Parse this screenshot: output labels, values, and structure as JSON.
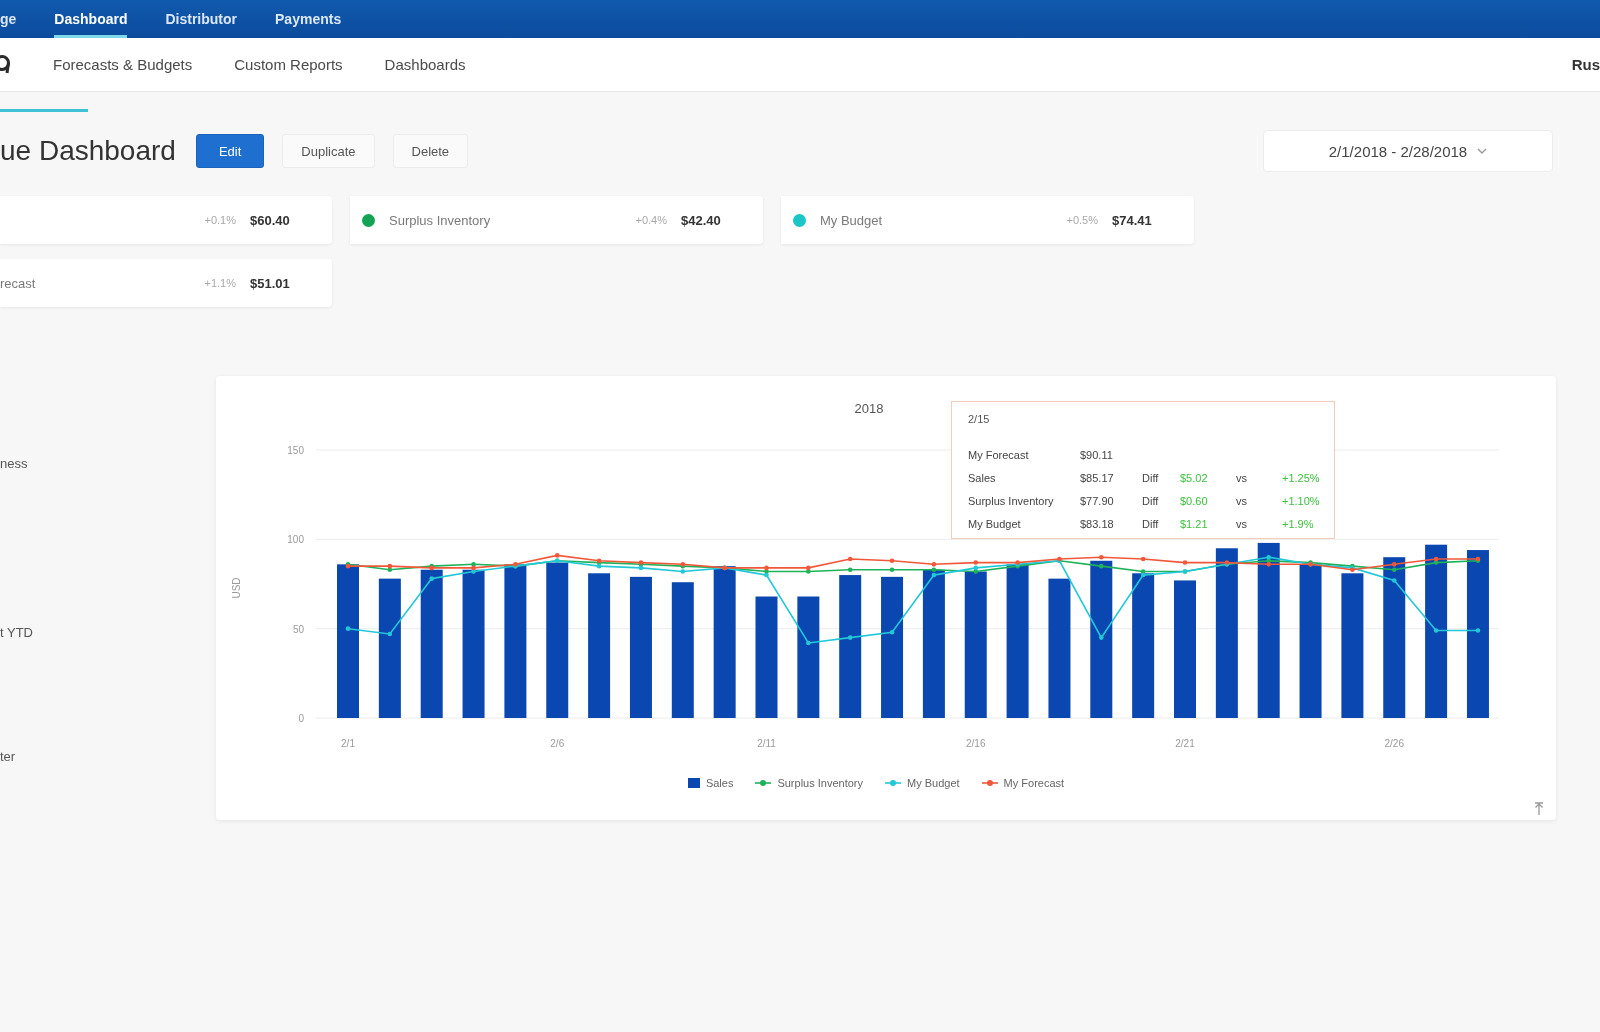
{
  "top_nav": {
    "items": [
      {
        "label": "ge",
        "selected": false
      },
      {
        "label": "Dashboard",
        "selected": true
      },
      {
        "label": "Distributor",
        "selected": false
      },
      {
        "label": "Payments",
        "selected": false
      }
    ]
  },
  "sub_nav": {
    "items": [
      "Forecasts & Budgets",
      "Custom Reports",
      "Dashboards"
    ],
    "user": "Rus"
  },
  "title": "ue Dashboard",
  "actions": [
    {
      "label": "Edit",
      "kind": "primary"
    },
    {
      "label": "Duplicate",
      "kind": "default"
    },
    {
      "label": "Delete",
      "kind": "default"
    }
  ],
  "date_range": {
    "value": "2/1/2018 - 2/28/2018"
  },
  "metric_cards": [
    {
      "change": "+0.1%",
      "value": "$60.40"
    },
    {
      "label": "Surplus Inventory",
      "color": "#12a454",
      "change": "+0.4%",
      "value": "$42.40"
    },
    {
      "label": "My Budget",
      "color": "#1cc6c6",
      "change": "+0.5%",
      "value": "$74.41"
    },
    {
      "label": "recast",
      "change": "+1.1%",
      "value": "$51.01"
    }
  ],
  "sidebar": {
    "items": [
      "ness",
      "t YTD",
      "ter"
    ]
  },
  "chart": {
    "chart_data": [
      {
        "type": "bar",
        "title": "2018",
        "ylabel": "USD",
        "categories": [
          "2/1",
          null,
          null,
          null,
          null,
          "2/6",
          null,
          null,
          null,
          null,
          "2/11",
          null,
          null,
          null,
          null,
          "2/16",
          null,
          null,
          null,
          null,
          "2/21",
          null,
          null,
          null,
          null,
          "2/26",
          null,
          null
        ],
        "ylim": [
          0,
          150
        ],
        "yticks": [
          0,
          50,
          100,
          150
        ],
        "grid": true,
        "legend": "bottom",
        "series": [
          {
            "name": "Sales",
            "type": "bar",
            "color": "#0b47b0",
            "values": [
              86,
              78,
              83,
              83,
              86,
              87,
              81,
              79,
              76,
              85,
              68,
              68,
              80,
              79,
              83,
              82,
              86,
              78,
              88,
              81,
              77,
              95,
              98,
              86,
              81,
              90,
              97,
              94
            ]
          },
          {
            "name": "Surplus Inventory",
            "type": "line",
            "color": "#1fb25a",
            "values": [
              86,
              83,
              85,
              86,
              85,
              88,
              87,
              86,
              85,
              84,
              82,
              82,
              83,
              83,
              83,
              82,
              85,
              88,
              85,
              82,
              82,
              86,
              88,
              87,
              85,
              83,
              87,
              88
            ]
          },
          {
            "name": "My Budget",
            "type": "line",
            "color": "#22c8d8",
            "values": [
              50,
              47,
              78,
              82,
              85,
              88,
              85,
              84,
              82,
              84,
              80,
              42,
              45,
              48,
              80,
              84,
              86,
              88,
              45,
              80,
              82,
              86,
              90,
              86,
              84,
              77,
              49,
              49
            ]
          },
          {
            "name": "My Forecast",
            "type": "line",
            "color": "#f0583a",
            "values": [
              85,
              85,
              84,
              84,
              86,
              91,
              88,
              87,
              86,
              84,
              84,
              84,
              89,
              88,
              86,
              87,
              87,
              89,
              90,
              89,
              87,
              87,
              86,
              86,
              83,
              86,
              89,
              89
            ]
          }
        ]
      }
    ],
    "tooltip": {
      "title": "2/15",
      "rows": [
        {
          "label": "My Forecast",
          "value": "$90.11"
        },
        {
          "label": "Sales",
          "value": "$85.17",
          "diff_label": "Diff",
          "diff": "$5.02",
          "vs_label": "vs",
          "vs": "+1.25%"
        },
        {
          "label": "Surplus Inventory",
          "value": "$77.90",
          "diff_label": "Diff",
          "diff": "$0.60",
          "vs_label": "vs",
          "vs": "+1.10%"
        },
        {
          "label": "My Budget",
          "value": "$83.18",
          "diff_label": "Diff",
          "diff": "$1.21",
          "vs_label": "vs",
          "vs": "+1.9%"
        }
      ]
    }
  }
}
